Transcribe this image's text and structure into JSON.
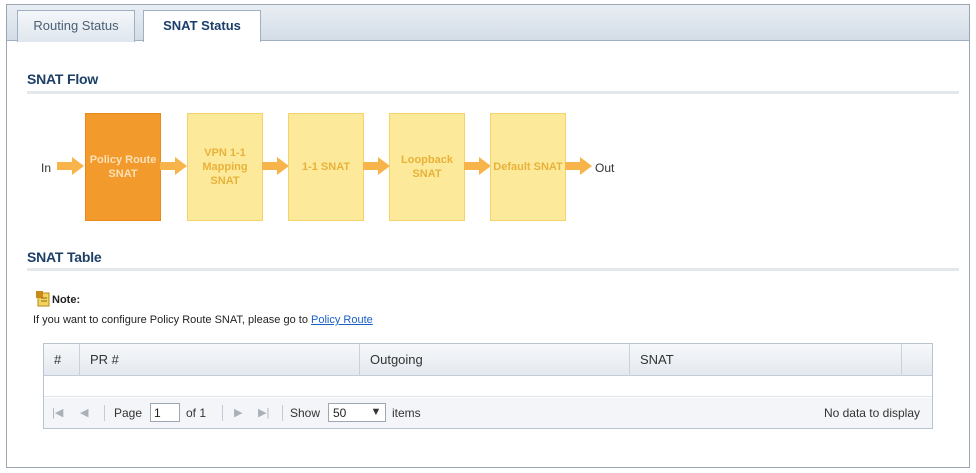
{
  "tabs": [
    {
      "label": "Routing Status"
    },
    {
      "label": "SNAT Status"
    }
  ],
  "snat_flow": {
    "title": "SNAT Flow",
    "in_label": "In",
    "out_label": "Out",
    "steps": [
      {
        "label": "Policy Route SNAT"
      },
      {
        "label": "VPN 1-1 Mapping SNAT"
      },
      {
        "label": "1-1 SNAT"
      },
      {
        "label": "Loopback SNAT"
      },
      {
        "label": "Default SNAT"
      }
    ]
  },
  "snat_table": {
    "title": "SNAT Table",
    "note_title": "Note:",
    "note_text": "If you want to configure Policy Route SNAT, please go to ",
    "note_link": "Policy Route",
    "columns": [
      "#",
      "PR #",
      "Outgoing",
      "SNAT"
    ],
    "pager": {
      "page_label": "Page",
      "page_value": "1",
      "of_label": "of 1",
      "show_label": "Show",
      "show_value": "50",
      "items_label": "items",
      "empty_text": "No data to display"
    }
  },
  "colors": {
    "active_step": "#f29a2b",
    "step": "#fde99a",
    "arrow": "#f7b44a",
    "title": "#1d3f66",
    "link": "#1a5fc6"
  }
}
